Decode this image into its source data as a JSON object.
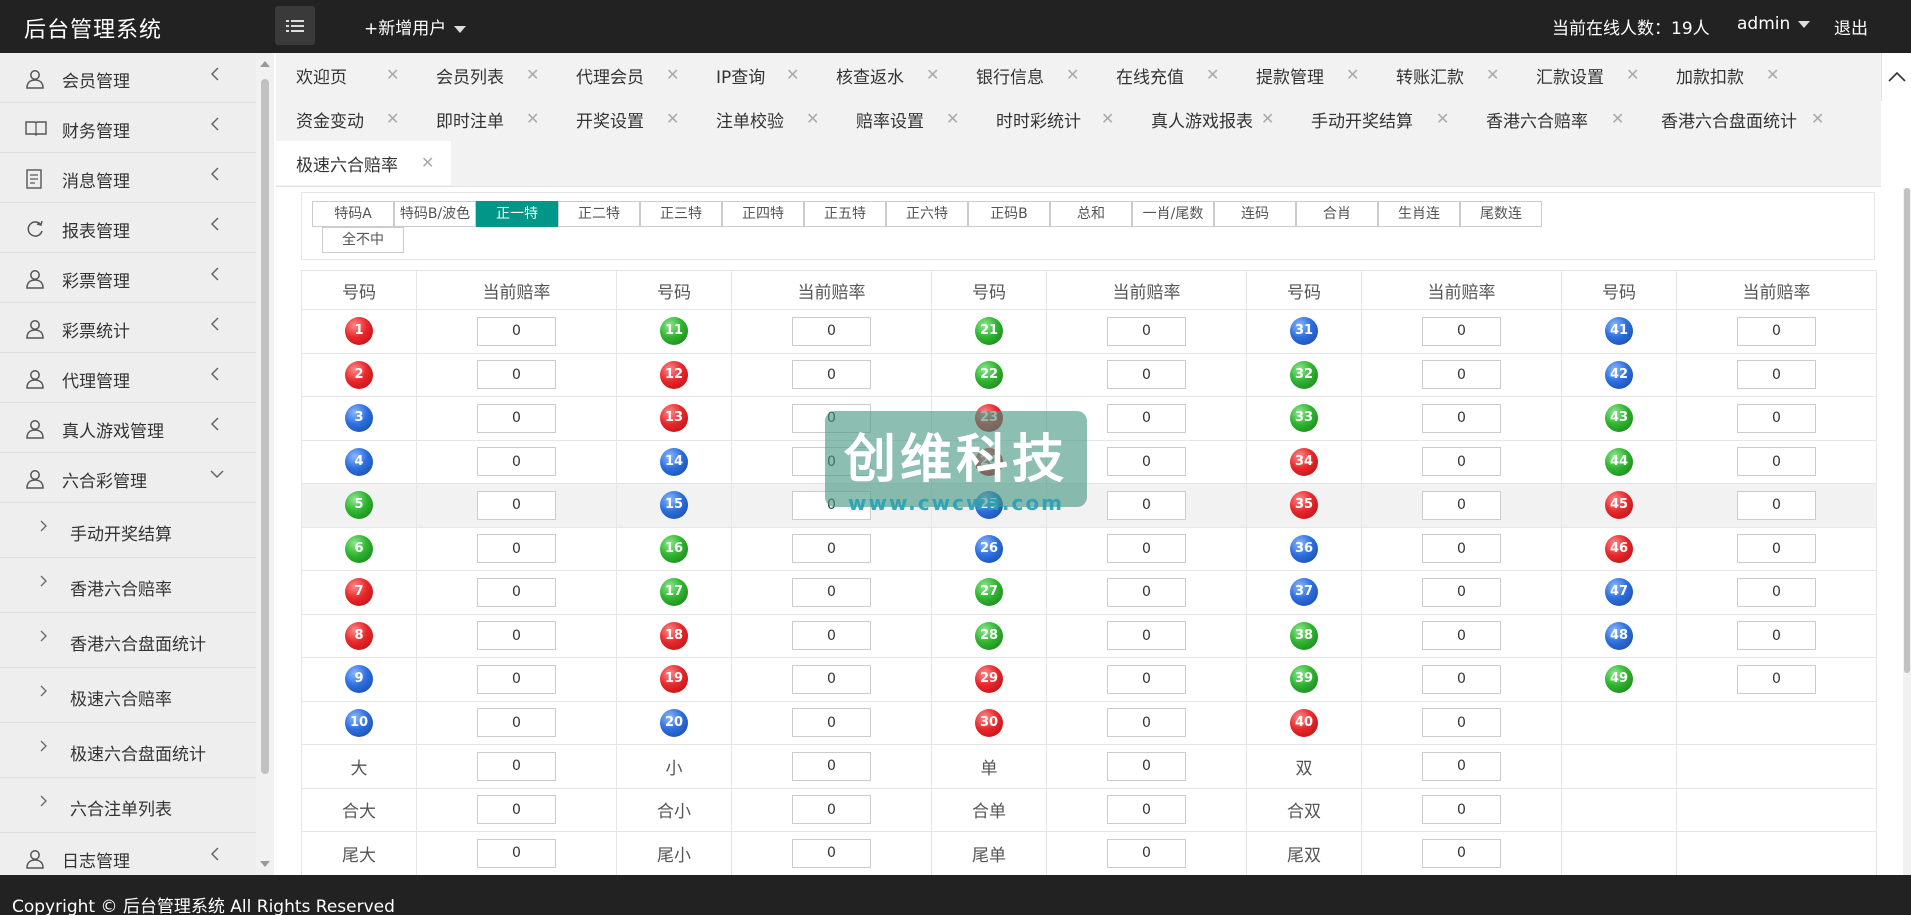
{
  "header": {
    "app_title": "后台管理系统",
    "add_user": "+新增用户",
    "online_label": "当前在线人数：19人",
    "admin_label": "admin",
    "logout_label": "退出"
  },
  "sidebar": {
    "items": [
      {
        "label": "会员管理",
        "icon": "user-icon"
      },
      {
        "label": "财务管理",
        "icon": "book-icon"
      },
      {
        "label": "消息管理",
        "icon": "document-icon"
      },
      {
        "label": "报表管理",
        "icon": "refresh-icon"
      },
      {
        "label": "彩票管理",
        "icon": "user-icon"
      },
      {
        "label": "彩票统计",
        "icon": "user-icon"
      },
      {
        "label": "代理管理",
        "icon": "user-icon"
      },
      {
        "label": "真人游戏管理",
        "icon": "user-icon"
      },
      {
        "label": "六合彩管理",
        "icon": "user-icon",
        "expanded": true
      }
    ],
    "sub_items": [
      "手动开奖结算",
      "香港六合赔率",
      "香港六合盘面统计",
      "极速六合赔率",
      "极速六合盘面统计",
      "六合注单列表"
    ],
    "last_item": {
      "label": "日志管理",
      "icon": "user-icon"
    }
  },
  "tabs": {
    "row1": [
      "欢迎页",
      "会员列表",
      "代理会员",
      "IP查询",
      "核查返水",
      "银行信息",
      "在线充值",
      "提款管理",
      "转账汇款",
      "汇款设置",
      "加款扣款"
    ],
    "row2": [
      "资金变动",
      "即时注单",
      "开奖设置",
      "注单校验",
      "赔率设置",
      "时时彩统计",
      "真人游戏报表",
      "手动开奖结算",
      "香港六合赔率",
      "香港六合盘面统计"
    ],
    "row3": [
      "极速六合赔率"
    ],
    "active": "极速六合赔率",
    "close_glyph": "✕"
  },
  "filters": {
    "buttons": [
      "特码A",
      "特码B/波色",
      "正一特",
      "正二特",
      "正三特",
      "正四特",
      "正五特",
      "正六特",
      "正码B",
      "总和",
      "一肖/尾数",
      "连码",
      "合肖",
      "生肖连",
      "尾数连",
      "全不中"
    ],
    "active": "正一特"
  },
  "table": {
    "col_num_header": "号码",
    "col_odds_header": "当前赔率",
    "ball_colors": {
      "red": "#e8282b",
      "green": "#2fb52f",
      "blue": "#2d6fe0"
    },
    "numbers": [
      [
        {
          "n": "1",
          "c": "red"
        },
        {
          "n": "11",
          "c": "green"
        },
        {
          "n": "21",
          "c": "green"
        },
        {
          "n": "31",
          "c": "blue"
        },
        {
          "n": "41",
          "c": "blue"
        }
      ],
      [
        {
          "n": "2",
          "c": "red"
        },
        {
          "n": "12",
          "c": "red"
        },
        {
          "n": "22",
          "c": "green"
        },
        {
          "n": "32",
          "c": "green"
        },
        {
          "n": "42",
          "c": "blue"
        }
      ],
      [
        {
          "n": "3",
          "c": "blue"
        },
        {
          "n": "13",
          "c": "red"
        },
        {
          "n": "23",
          "c": "red"
        },
        {
          "n": "33",
          "c": "green"
        },
        {
          "n": "43",
          "c": "green"
        }
      ],
      [
        {
          "n": "4",
          "c": "blue"
        },
        {
          "n": "14",
          "c": "blue"
        },
        {
          "n": "24",
          "c": "red"
        },
        {
          "n": "34",
          "c": "red"
        },
        {
          "n": "44",
          "c": "green"
        }
      ],
      [
        {
          "n": "5",
          "c": "green"
        },
        {
          "n": "15",
          "c": "blue"
        },
        {
          "n": "25",
          "c": "blue"
        },
        {
          "n": "35",
          "c": "red"
        },
        {
          "n": "45",
          "c": "red"
        }
      ],
      [
        {
          "n": "6",
          "c": "green"
        },
        {
          "n": "16",
          "c": "green"
        },
        {
          "n": "26",
          "c": "blue"
        },
        {
          "n": "36",
          "c": "blue"
        },
        {
          "n": "46",
          "c": "red"
        }
      ],
      [
        {
          "n": "7",
          "c": "red"
        },
        {
          "n": "17",
          "c": "green"
        },
        {
          "n": "27",
          "c": "green"
        },
        {
          "n": "37",
          "c": "blue"
        },
        {
          "n": "47",
          "c": "blue"
        }
      ],
      [
        {
          "n": "8",
          "c": "red"
        },
        {
          "n": "18",
          "c": "red"
        },
        {
          "n": "28",
          "c": "green"
        },
        {
          "n": "38",
          "c": "green"
        },
        {
          "n": "48",
          "c": "blue"
        }
      ],
      [
        {
          "n": "9",
          "c": "blue"
        },
        {
          "n": "19",
          "c": "red"
        },
        {
          "n": "29",
          "c": "red"
        },
        {
          "n": "39",
          "c": "green"
        },
        {
          "n": "49",
          "c": "green"
        }
      ],
      [
        {
          "n": "10",
          "c": "blue"
        },
        {
          "n": "20",
          "c": "blue"
        },
        {
          "n": "30",
          "c": "red"
        },
        {
          "n": "40",
          "c": "red"
        }
      ]
    ],
    "text_rows": [
      [
        "大",
        "小",
        "单",
        "双"
      ],
      [
        "合大",
        "合小",
        "合单",
        "合双"
      ],
      [
        "尾大",
        "尾小",
        "尾单",
        "尾双"
      ]
    ],
    "default_odds": "0",
    "highlighted_row": 4
  },
  "watermark": {
    "title": "创维科技",
    "url": "www.cwcwa.com"
  },
  "footer": {
    "copyright": "Copyright © 后台管理系统 All Rights Reserved"
  }
}
